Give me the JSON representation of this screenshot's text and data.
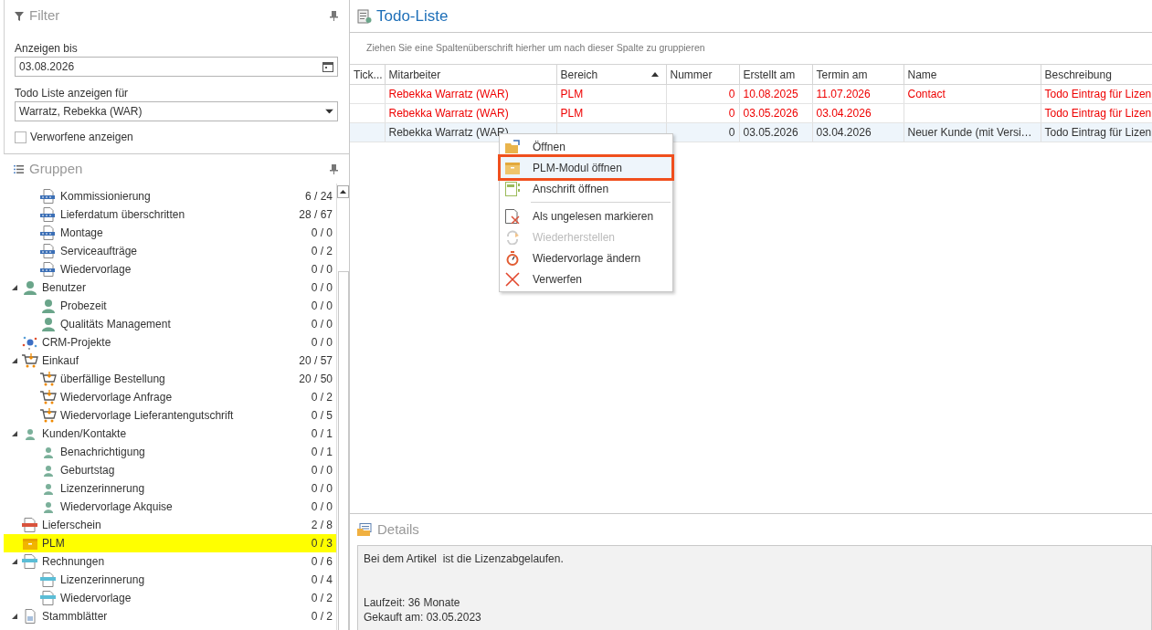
{
  "filter": {
    "title": "Filter",
    "date_label": "Anzeigen bis",
    "date_value": "03.08.2026",
    "person_label": "Todo Liste anzeigen für",
    "person_value": "Warratz, Rebekka (WAR)",
    "discarded": {
      "label": "Verworfene anzeigen",
      "checked": false
    }
  },
  "groups": {
    "title": "Gruppen",
    "tree": [
      {
        "children": [
          {
            "label": "Kommissionierung",
            "count": "6 / 24",
            "kind": "order",
            "selected": false
          },
          {
            "label": "Lieferdatum überschritten",
            "count": "28 / 67",
            "kind": "order",
            "selected": false
          },
          {
            "label": "Montage",
            "count": "0 / 0",
            "kind": "order",
            "selected": false
          },
          {
            "label": "Serviceaufträge",
            "count": "0 / 2",
            "kind": "order",
            "selected": false
          },
          {
            "label": "Wiedervorlage",
            "count": "0 / 0",
            "kind": "order",
            "selected": false
          }
        ]
      },
      {
        "label": "Benutzer",
        "count": "0 / 0",
        "kind": "user",
        "selected": false,
        "expanded": true,
        "children": [
          {
            "label": "Probezeit",
            "count": "0 / 0",
            "kind": "user",
            "selected": false
          },
          {
            "label": "Qualitäts Management",
            "count": "0 / 0",
            "kind": "user",
            "selected": false
          }
        ]
      },
      {
        "label": "CRM-Projekte",
        "count": "0 / 0",
        "kind": "crm",
        "selected": false
      },
      {
        "label": "Einkauf",
        "count": "20 / 57",
        "kind": "cart",
        "selected": false,
        "expanded": true,
        "children": [
          {
            "label": "überfällige Bestellung",
            "count": "20 / 50",
            "kind": "cart",
            "selected": false
          },
          {
            "label": "Wiedervorlage Anfrage",
            "count": "0 / 2",
            "kind": "cart",
            "selected": false
          },
          {
            "label": "Wiedervorlage Lieferantengutschrift",
            "count": "0 / 5",
            "kind": "cart",
            "selected": false
          }
        ]
      },
      {
        "label": "Kunden/Kontakte",
        "count": "0 / 1",
        "kind": "contact",
        "selected": false,
        "expanded": true,
        "children": [
          {
            "label": "Benachrichtigung",
            "count": "0 / 1",
            "kind": "contact",
            "selected": false
          },
          {
            "label": "Geburtstag",
            "count": "0 / 0",
            "kind": "contact",
            "selected": false
          },
          {
            "label": "Lizenzerinnerung",
            "count": "0 / 0",
            "kind": "contact",
            "selected": false
          },
          {
            "label": "Wiedervorlage Akquise",
            "count": "0 / 0",
            "kind": "contact",
            "selected": false
          }
        ]
      },
      {
        "label": "Lieferschein",
        "count": "2 / 8",
        "kind": "delivery",
        "selected": false
      },
      {
        "label": "PLM",
        "count": "0 / 3",
        "kind": "box",
        "selected": true
      },
      {
        "label": "Rechnungen",
        "count": "0 / 6",
        "kind": "invoice",
        "selected": false,
        "expanded": true,
        "children": [
          {
            "label": "Lizenzerinnerung",
            "count": "0 / 4",
            "kind": "invoice",
            "selected": false
          },
          {
            "label": "Wiedervorlage",
            "count": "0 / 2",
            "kind": "invoice",
            "selected": false
          }
        ]
      },
      {
        "label": "Stammblätter",
        "count": "0 / 2",
        "kind": "sheet",
        "selected": false,
        "expanded": true
      }
    ]
  },
  "todo": {
    "title": "Todo-Liste",
    "group_hint": "Ziehen Sie eine Spaltenüberschrift hierher um nach dieser Spalte zu gruppieren",
    "columns": [
      {
        "label": "Tick...",
        "sorted": false
      },
      {
        "label": "Mitarbeiter",
        "sorted": false
      },
      {
        "label": "Bereich",
        "sorted": true
      },
      {
        "label": "Nummer",
        "sorted": false
      },
      {
        "label": "Erstellt am",
        "sorted": false
      },
      {
        "label": "Termin am",
        "sorted": false
      },
      {
        "label": "Name",
        "sorted": false
      },
      {
        "label": "Beschreibung",
        "sorted": false
      }
    ],
    "rows": [
      {
        "mitarbeiter": "Rebekka Warratz (WAR)",
        "bereich": "PLM",
        "nummer": "0",
        "erstellt_am": "10.08.2025",
        "termin_am": "11.07.2026",
        "name": "Contact",
        "beschreibung": "Todo Eintrag für Lizen",
        "overdue": true,
        "selected": false
      },
      {
        "mitarbeiter": "Rebekka Warratz (WAR)",
        "bereich": "PLM",
        "nummer": "0",
        "erstellt_am": "03.05.2026",
        "termin_am": "03.04.2026",
        "beschreibung": "Todo Eintrag für Lizen",
        "overdue": true,
        "selected": false
      },
      {
        "mitarbeiter": "Rebekka Warratz (WAR)",
        "nummer": "0",
        "erstellt_am": "03.05.2026",
        "termin_am": "03.04.2026",
        "name": "Neuer Kunde  (mit Versi…",
        "beschreibung": "Todo Eintrag für Lizen",
        "overdue": false,
        "selected": true
      }
    ]
  },
  "context_menu": [
    {
      "kind": "open",
      "label": "Öffnen",
      "disabled": false,
      "selected": false
    },
    {
      "kind": "module",
      "label": "PLM-Modul öffnen",
      "disabled": false,
      "selected": true
    },
    {
      "kind": "address",
      "label": "Anschrift öffnen",
      "disabled": false,
      "selected": false
    },
    {
      "kind": "separator"
    },
    {
      "kind": "unread",
      "label": "Als ungelesen markieren",
      "disabled": false,
      "selected": false
    },
    {
      "kind": "restore",
      "label": "Wiederherstellen",
      "disabled": true,
      "selected": false
    },
    {
      "kind": "timer",
      "label": "Wiedervorlage ändern",
      "disabled": false,
      "selected": false
    },
    {
      "kind": "discard",
      "label": "Verwerfen",
      "disabled": false,
      "selected": false
    }
  ],
  "details": {
    "title": "Details",
    "lines": [
      "Bei dem Artikel  ist die Lizenzabgelaufen.",
      "Laufzeit: 36 Monate",
      "Gekauft am: 03.05.2023"
    ]
  }
}
